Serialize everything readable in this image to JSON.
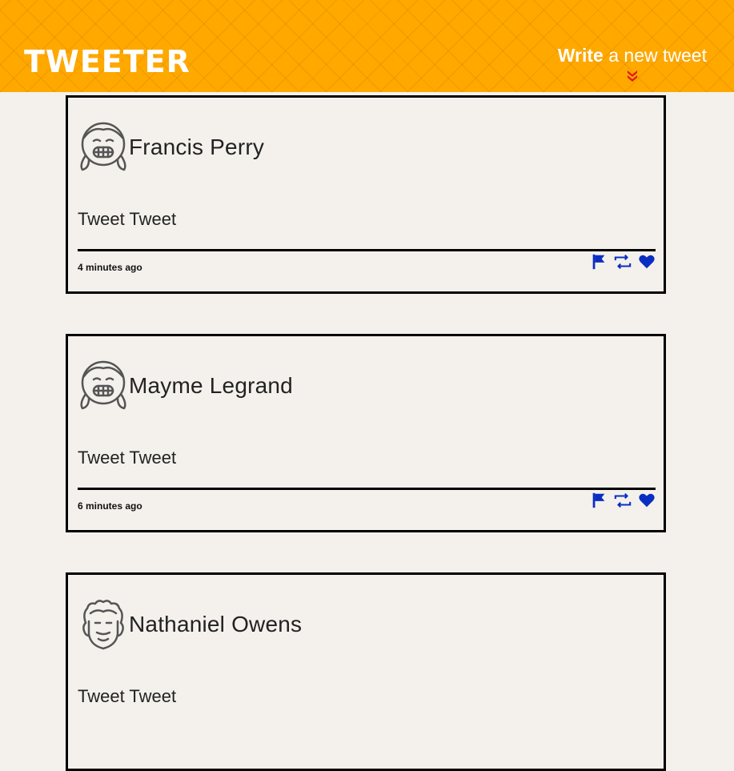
{
  "header": {
    "brand": "TWEETER",
    "compose_bold": "Write",
    "compose_rest": " a new tweet"
  },
  "colors": {
    "nav_bg": "#ffa800",
    "page_bg": "#f4f1ec",
    "action_icons": "#0a2ec2",
    "compose_chevron": "#e21a1a"
  },
  "tweets": [
    {
      "name": "Francis Perry",
      "text": "Tweet Tweet",
      "time": "4 minutes ago",
      "avatar": "girl-avatar-icon"
    },
    {
      "name": "Mayme Legrand",
      "text": "Tweet Tweet",
      "time": "6 minutes ago",
      "avatar": "girl-avatar-icon"
    },
    {
      "name": "Nathaniel Owens",
      "text": "Tweet Tweet",
      "time": "",
      "avatar": "curly-hair-avatar-icon"
    }
  ],
  "actions": [
    "flag-icon",
    "retweet-icon",
    "heart-icon"
  ]
}
